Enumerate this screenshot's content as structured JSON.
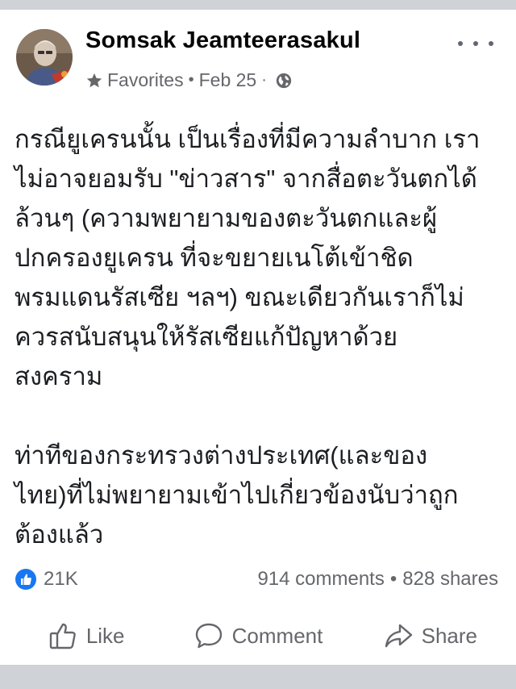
{
  "post": {
    "author": "Somsak Jeamteerasakul",
    "audience_label": "Favorites",
    "separator": "•",
    "date": "Feb 25",
    "date_separator": "·",
    "body": "กรณียูเครนนั้น เป็นเรื่องที่มีความลำบาก เรา\nไม่อาจยอมรับ \"ข่าวสาร\" จากสื่อตะวันตกได้\nล้วนๆ (ความพยายามของตะวันตกและผู้\nปกครองยูเครน ที่จะขยายเนโต้เข้าชิด\nพรมแดนรัสเซีย ฯลฯ) ขณะเดียวกันเราก็ไม่\nควรสนับสนุนให้รัสเซียแก้ปัญหาด้วย\nสงคราม\n\nท่าทีของกระทรวงต่างประเทศ(และของ\nไทย)ที่ไม่พยายามเข้าไปเกี่ยวข้องนับว่าถูก\nต้องแล้ว"
  },
  "stats": {
    "reactions": "21K",
    "comments": "914 comments",
    "separator": "•",
    "shares": "828 shares"
  },
  "actions": {
    "like": "Like",
    "comment": "Comment",
    "share": "Share"
  },
  "icons": {
    "audience": "star-icon",
    "privacy": "globe-icon",
    "more": "more-options-icon",
    "like": "thumbs-up-icon",
    "comment": "speech-bubble-icon",
    "share": "share-arrow-icon"
  },
  "colors": {
    "like_blue": "#1877f2",
    "secondary_text": "#65676b",
    "primary_text": "#050505",
    "background": "#cfd2d6"
  }
}
